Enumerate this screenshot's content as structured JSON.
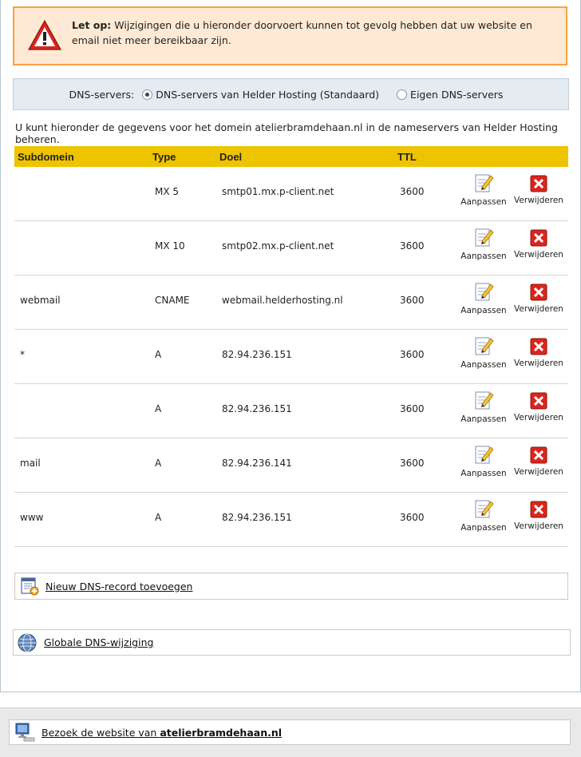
{
  "warning": {
    "bold": "Let op:",
    "text": " Wijzigingen die u hieronder doorvoert kunnen tot gevolg hebben dat uw website en email niet meer bereikbaar zijn.",
    "icon": "warning-triangle-icon"
  },
  "dns": {
    "label": "DNS-servers:",
    "options": [
      {
        "label": "DNS-servers van Helder Hosting (Standaard)",
        "checked": true
      },
      {
        "label": "Eigen DNS-servers",
        "checked": false
      }
    ]
  },
  "intro": "U kunt hieronder de gegevens voor het domein atelierbramdehaan.nl in de nameservers van Helder Hosting beheren.",
  "table": {
    "headers": [
      "Subdomein",
      "Type",
      "Doel",
      "TTL"
    ],
    "edit_label": "Aanpassen",
    "delete_label": "Verwijderen",
    "rows": [
      {
        "sub": "",
        "type": "MX 5",
        "target": "smtp01.mx.p-client.net",
        "ttl": "3600"
      },
      {
        "sub": "",
        "type": "MX 10",
        "target": "smtp02.mx.p-client.net",
        "ttl": "3600"
      },
      {
        "sub": "webmail",
        "type": "CNAME",
        "target": "webmail.helderhosting.nl",
        "ttl": "3600"
      },
      {
        "sub": "*",
        "type": "A",
        "target": "82.94.236.151",
        "ttl": "3600"
      },
      {
        "sub": "",
        "type": "A",
        "target": "82.94.236.151",
        "ttl": "3600"
      },
      {
        "sub": "mail",
        "type": "A",
        "target": "82.94.236.141",
        "ttl": "3600"
      },
      {
        "sub": "www",
        "type": "A",
        "target": "82.94.236.151",
        "ttl": "3600"
      }
    ]
  },
  "links": {
    "new_record": "Nieuw DNS-record toevoegen",
    "global": "Globale DNS-wijziging",
    "visit_prefix": "Bezoek de website van ",
    "visit_domain": "atelierbramdehaan.nl"
  },
  "colors": {
    "header_bg": "#eec300",
    "warning_bg": "#fde9d4",
    "warning_border": "#f7a340",
    "delete_red": "#d9261c"
  }
}
